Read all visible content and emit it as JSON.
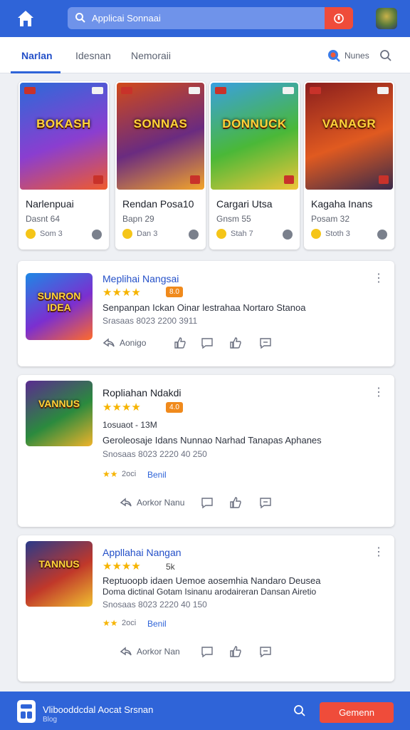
{
  "header": {
    "search_text": "Applicai  Sonnaai",
    "icons": [
      "home-icon",
      "search-icon",
      "microphone-icon",
      "user-avatar"
    ]
  },
  "tabs": {
    "items": [
      {
        "label": "Narlan"
      },
      {
        "label": "Idesnan"
      },
      {
        "label": "Nemoraii"
      }
    ],
    "news_label": "Nunes"
  },
  "games": [
    {
      "art_title": "BOKASH",
      "name": "Narlenpuai",
      "sub": "Dasnt 64",
      "meta": "Som  3",
      "colors": [
        "#2c6ad8",
        "#8a3ed0",
        "#f05b2c"
      ]
    },
    {
      "art_title": "SONNAS",
      "name": "Rendan Posa10",
      "sub": "Bapn 29",
      "meta": "Dan  3",
      "colors": [
        "#d14a1a",
        "#6a2b80",
        "#f3a52a"
      ]
    },
    {
      "art_title": "DONNUCK",
      "name": "Cargari Utsa",
      "sub": "Gnsm 55",
      "meta": "Stah  7",
      "colors": [
        "#3aa0e0",
        "#4ab838",
        "#f0c63a"
      ]
    },
    {
      "art_title": "VANAGR",
      "name": "Kagaha Inans",
      "sub": "Posam 32",
      "meta": "Stoth  3",
      "colors": [
        "#8a1e1e",
        "#e05a20",
        "#3a2a4a"
      ]
    }
  ],
  "apps": [
    {
      "art_title": "SUNRON IDEA",
      "title": "Meplihai  Nangsai",
      "stars": "★★★★",
      "rating": "8.0",
      "line1": "Senpanpan  Ickan  Oinar  lestrahaa  Nortaro  Stanoa",
      "line2": "Srasaas    8023    2200    3911",
      "actions_label": "Aonigo",
      "colors": [
        "#1e88e5",
        "#7b2fd0",
        "#ff6a2a"
      ]
    },
    {
      "art_title": "VANNUS",
      "title": "Ropliahan  Ndakdi",
      "stars": "★★★★",
      "rating": "4.0",
      "line0": "1osuaot - 13M",
      "line1": "Geroleosaje  Idans  Nunnao  Narhad  Tanapas  Aphanes",
      "line2": "Snosaas    8023    2220   40   250",
      "small_stars": "★★",
      "small_meta": "2oci",
      "small_link": "Benil",
      "actions_label": "Aorkor   Nanu",
      "colors": [
        "#5a2b90",
        "#2b8a3e",
        "#f0b32a"
      ]
    },
    {
      "art_title": "TANNUS",
      "title": "Appllahai  Nangan",
      "stars": "★★★★",
      "rating": "5k",
      "line1": "Reptuoopb  idaen  Uemoe  aosemhia  Nandaro  Deusea",
      "line1b": "Doma  dictinal  Gotam  Isinanu  arodaireran  Dansan  Airetio",
      "line2": "Snosaas    8023    2220   40   150",
      "small_stars": "★★",
      "small_meta": "2oci",
      "small_link": "Benil",
      "actions_label": "Aorkor   Nan",
      "colors": [
        "#2a3a8a",
        "#c0382a",
        "#f0c030"
      ]
    }
  ],
  "bottom": {
    "title": "Vlibooddcdal  Aocat  Srsnan",
    "sub": "Blog",
    "button": "Gemenn"
  }
}
